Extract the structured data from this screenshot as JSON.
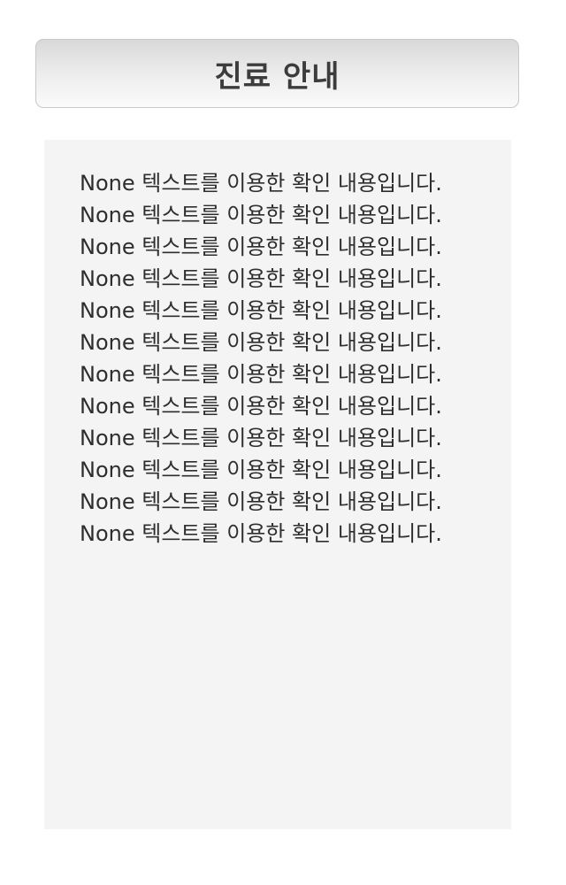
{
  "header": {
    "title": "진료 안내"
  },
  "content": {
    "lines": [
      "None 텍스트를 이용한 확인 내용입니다.",
      "None 텍스트를 이용한 확인 내용입니다.",
      "None 텍스트를 이용한 확인 내용입니다.",
      "None 텍스트를 이용한 확인 내용입니다.",
      "None 텍스트를 이용한 확인 내용입니다.",
      "None 텍스트를 이용한 확인 내용입니다.",
      "None 텍스트를 이용한 확인 내용입니다.",
      "None 텍스트를 이용한 확인 내용입니다.",
      "None 텍스트를 이용한 확인 내용입니다.",
      "None 텍스트를 이용한 확인 내용입니다.",
      "None 텍스트를 이용한 확인 내용입니다.",
      "None 텍스트를 이용한 확인 내용입니다."
    ]
  },
  "colors": {
    "header_gradient_top": "#d9d9d9",
    "header_gradient_bottom": "#fafafa",
    "panel_background": "#f4f4f4",
    "text": "#2e2e2e"
  }
}
